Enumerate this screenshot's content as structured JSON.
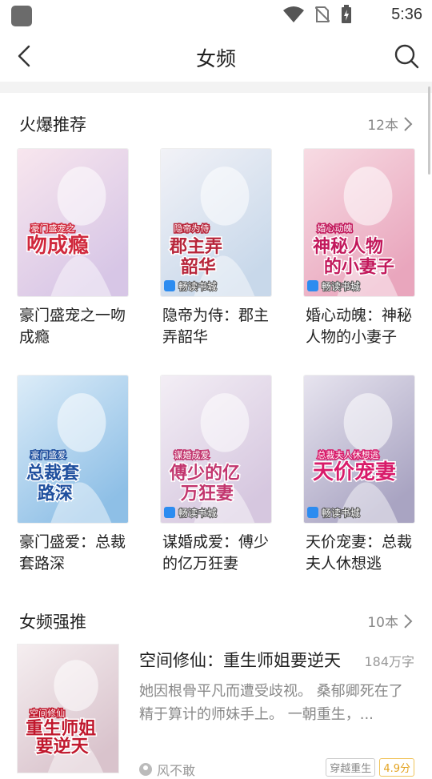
{
  "status_bar": {
    "time": "5:36"
  },
  "nav": {
    "title": "女频"
  },
  "hot": {
    "title": "火爆推荐",
    "more": "12本",
    "books": [
      {
        "name": "豪门盛宠之一吻成瘾",
        "cover_title": "吻成瘾",
        "cover_sub": "豪门盛宠之",
        "colors": [
          "#f8e6ee",
          "#d7c6e6"
        ],
        "accent": "#d0283c"
      },
      {
        "name": "隐帝为侍：郡主弄韶华",
        "cover_title": "郡主弄韶华",
        "cover_sub": "隐帝为侍",
        "colors": [
          "#f2f2f7",
          "#c8d8ea"
        ],
        "accent": "#b7253a",
        "publisher": "畅读书城"
      },
      {
        "name": "婚心动魄：神秘人物的小妻子",
        "cover_title": "神秘人物的小妻子",
        "cover_sub": "婚心动魄",
        "colors": [
          "#f7dbe3",
          "#e9a6bd"
        ],
        "accent": "#c2185b",
        "publisher": "畅读书城"
      },
      {
        "name": "豪门盛爱：总裁套路深",
        "cover_title": "总裁套路深",
        "cover_sub": "豪门盛爱",
        "colors": [
          "#dcecf8",
          "#8ebfe6"
        ],
        "accent": "#1f4f9e"
      },
      {
        "name": "谋婚成爱：傅少的亿万狂妻",
        "cover_title": "傅少的亿万狂妻",
        "cover_sub": "谋婚成爱",
        "colors": [
          "#f3eef5",
          "#d6c7df"
        ],
        "accent": "#c2366e",
        "publisher": "畅读书城"
      },
      {
        "name": "天价宠妻：总裁夫人休想逃",
        "cover_title": "天价宠妻",
        "cover_sub": "总裁夫人休想逃",
        "colors": [
          "#e7e4ef",
          "#a9a4c2"
        ],
        "accent": "#d81b6a",
        "publisher": "畅读书城"
      }
    ]
  },
  "strong": {
    "title": "女频强推",
    "more": "10本",
    "feature": {
      "title": "空间修仙：重生师姐要逆天",
      "words": "184万字",
      "desc": "她因根骨平凡而遭受歧视。 桑郁卿死在了精于算计的师妹手上。 一朝重生，...",
      "author": "风不敢",
      "tags": [
        "穿越重生",
        "4.9分"
      ],
      "cover_title": "重生师姐要逆天",
      "cover_sub": "空间修仙",
      "colors": [
        "#f5eef0",
        "#d9c3cc"
      ],
      "accent": "#c0182d"
    }
  }
}
